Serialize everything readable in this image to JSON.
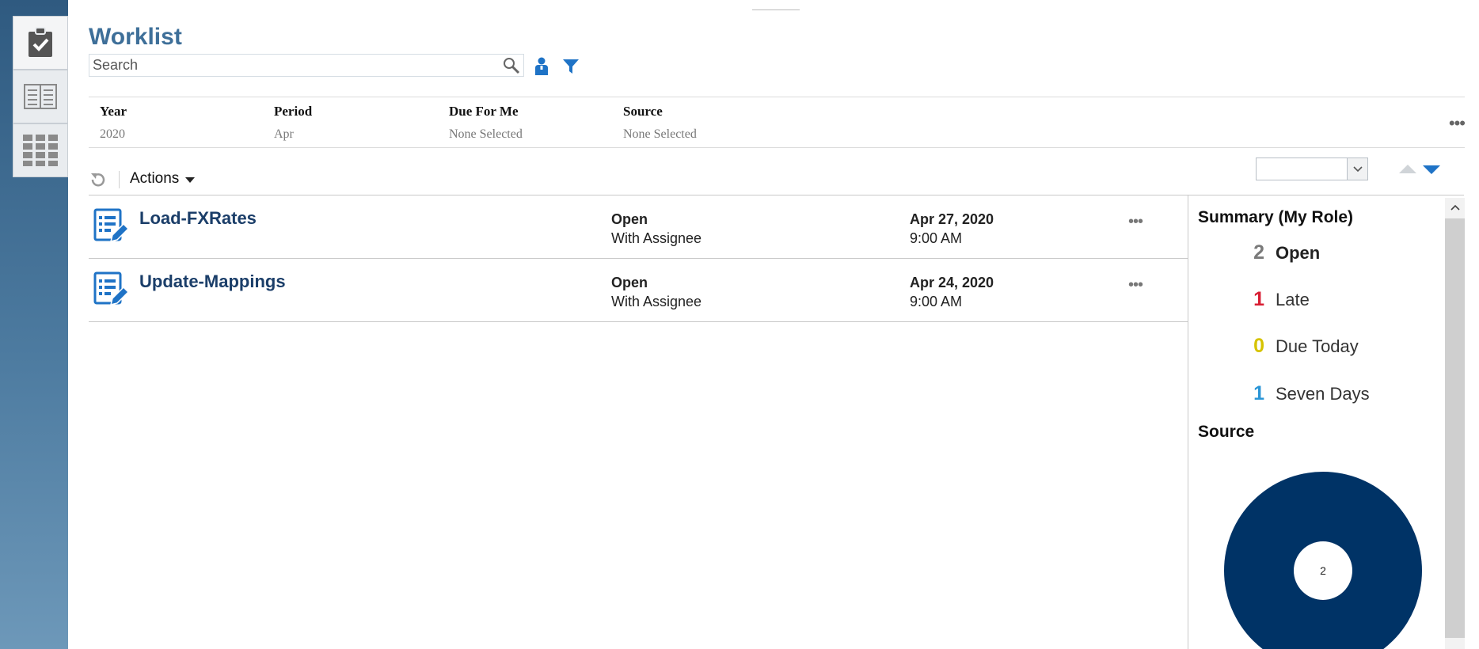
{
  "app": {
    "title": "Worklist"
  },
  "search": {
    "placeholder": "Search"
  },
  "filters": [
    {
      "label": "Year",
      "value": "2020"
    },
    {
      "label": "Period",
      "value": "Apr"
    },
    {
      "label": "Due For Me",
      "value": "None Selected"
    },
    {
      "label": "Source",
      "value": "None Selected"
    }
  ],
  "toolbar": {
    "actions_label": "Actions"
  },
  "tasks": [
    {
      "name": "Load-FXRates",
      "status": "Open",
      "substatus": "With Assignee",
      "date": "Apr 27, 2020",
      "time": "9:00 AM"
    },
    {
      "name": "Update-Mappings",
      "status": "Open",
      "substatus": "With Assignee",
      "date": "Apr 24, 2020",
      "time": "9:00 AM"
    }
  ],
  "summary": {
    "title": "Summary (My Role)",
    "items": [
      {
        "count": "2",
        "label": "Open",
        "color": "#7a7a7a"
      },
      {
        "count": "1",
        "label": "Late",
        "color": "#d81e33"
      },
      {
        "count": "0",
        "label": "Due Today",
        "color": "#d6c300"
      },
      {
        "count": "1",
        "label": "Seven Days",
        "color": "#2a95d6"
      }
    ]
  },
  "source": {
    "title": "Source",
    "donut_center": "2",
    "color": "#003366"
  },
  "colors": {
    "accent": "#1f73c6",
    "title": "#3e6f99",
    "task_name": "#1b3e69"
  },
  "icons": [
    "tasks-icon",
    "cards-icon",
    "grid-icon",
    "search-icon",
    "person-icon",
    "filter-icon",
    "refresh-icon",
    "task-edit-icon",
    "more-icon"
  ]
}
